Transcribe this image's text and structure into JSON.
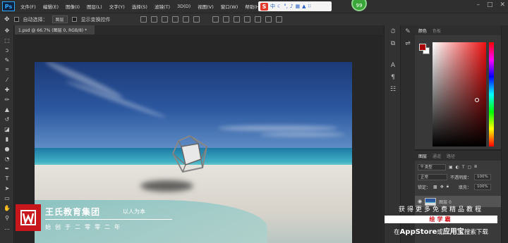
{
  "app": {
    "logo": "Ps"
  },
  "menu": [
    "文件(F)",
    "编辑(E)",
    "图像(I)",
    "图层(L)",
    "文字(Y)",
    "选择(S)",
    "滤镜(T)",
    "3D(D)",
    "视图(V)",
    "窗口(W)",
    "帮助(H)"
  ],
  "ime": {
    "logo": "S",
    "lang": "中"
  },
  "badge": "99",
  "options": {
    "auto_select": "自动选择：",
    "auto_select_value": "图层",
    "show_transform": "显示变换控件"
  },
  "document": {
    "tab_title": "1.psd @ 66.7% (图层 0, RGB/8) *"
  },
  "panels": {
    "color_tab": "颜色",
    "swatches_tab": "色板",
    "layers_tab": "图层",
    "channels_tab": "通道",
    "paths_tab": "路径",
    "kind_filter": "类型",
    "blend_mode": "正常",
    "opacity_label": "不透明度：",
    "opacity_value": "100%",
    "lock_label": "锁定：",
    "fill_label": "填充：",
    "fill_value": "100%",
    "layer_name": "图层 0",
    "foreground_color": "#aa0000",
    "background_color": "#ffffff"
  },
  "watermark": {
    "brand": "王氏教育集团",
    "slogan": "以人为本",
    "founded": "始创于二零零二年",
    "promo_line1": "获得更多免费精品教程",
    "promo_tag": "绘学霸",
    "promo_line3_pre": "在",
    "promo_line3_store": "AppStore",
    "promo_line3_mid": "或",
    "promo_line3_app": "应用宝",
    "promo_line3_post": "搜索下载"
  }
}
